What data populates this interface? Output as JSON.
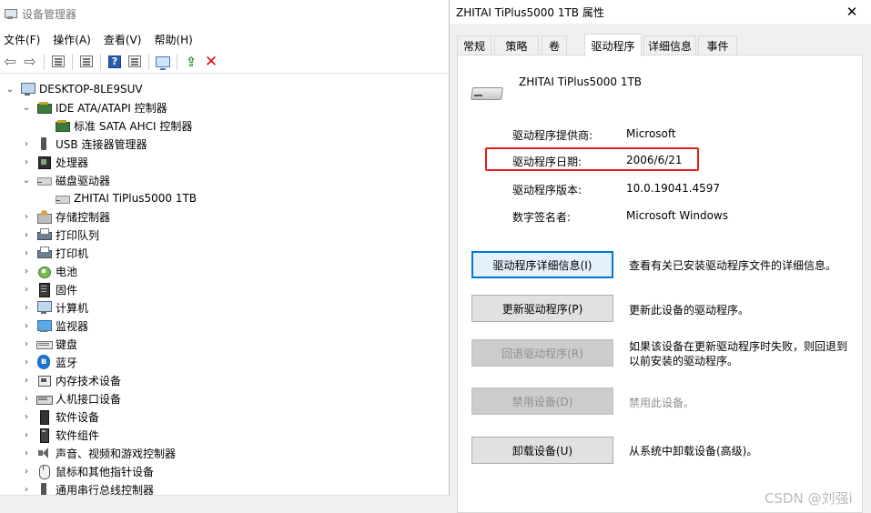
{
  "device_manager": {
    "title": "设备管理器",
    "menu": [
      "文件(F)",
      "操作(A)",
      "查看(V)",
      "帮助(H)"
    ],
    "tree": [
      {
        "label": "DESKTOP-8LE9SUV",
        "icon": "computer-icon",
        "level": 0,
        "expander": "expanded"
      },
      {
        "label": "IDE ATA/ATAPI 控制器",
        "icon": "ide-controller-icon",
        "level": 1,
        "expander": "expanded"
      },
      {
        "label": "标准 SATA AHCI 控制器",
        "icon": "ide-controller-icon",
        "level": 2,
        "expander": "none"
      },
      {
        "label": "USB 连接器管理器",
        "icon": "usb-icon",
        "level": 1,
        "expander": "collapsed"
      },
      {
        "label": "处理器",
        "icon": "processor-icon",
        "level": 1,
        "expander": "collapsed"
      },
      {
        "label": "磁盘驱动器",
        "icon": "disk-drive-icon",
        "level": 1,
        "expander": "expanded"
      },
      {
        "label": "ZHITAI TiPlus5000 1TB",
        "icon": "disk-drive-icon",
        "level": 2,
        "expander": "none"
      },
      {
        "label": "存储控制器",
        "icon": "storage-controller-icon",
        "level": 1,
        "expander": "collapsed"
      },
      {
        "label": "打印队列",
        "icon": "printer-icon",
        "level": 1,
        "expander": "collapsed"
      },
      {
        "label": "打印机",
        "icon": "printer-icon",
        "level": 1,
        "expander": "collapsed"
      },
      {
        "label": "电池",
        "icon": "battery-icon",
        "level": 1,
        "expander": "collapsed"
      },
      {
        "label": "固件",
        "icon": "firmware-icon",
        "level": 1,
        "expander": "collapsed"
      },
      {
        "label": "计算机",
        "icon": "computer-icon",
        "level": 1,
        "expander": "collapsed"
      },
      {
        "label": "监视器",
        "icon": "monitor-icon",
        "level": 1,
        "expander": "collapsed"
      },
      {
        "label": "键盘",
        "icon": "keyboard-icon",
        "level": 1,
        "expander": "collapsed"
      },
      {
        "label": "蓝牙",
        "icon": "bluetooth-icon",
        "level": 1,
        "expander": "collapsed"
      },
      {
        "label": "内存技术设备",
        "icon": "memory-icon",
        "level": 1,
        "expander": "collapsed"
      },
      {
        "label": "人机接口设备",
        "icon": "hid-icon",
        "level": 1,
        "expander": "collapsed"
      },
      {
        "label": "软件设备",
        "icon": "software-device-icon",
        "level": 1,
        "expander": "collapsed"
      },
      {
        "label": "软件组件",
        "icon": "software-component-icon",
        "level": 1,
        "expander": "collapsed"
      },
      {
        "label": "声音、视频和游戏控制器",
        "icon": "sound-icon",
        "level": 1,
        "expander": "collapsed"
      },
      {
        "label": "鼠标和其他指针设备",
        "icon": "mouse-icon",
        "level": 1,
        "expander": "collapsed"
      },
      {
        "label": "通用串行总线控制器",
        "icon": "usb-icon",
        "level": 1,
        "expander": "collapsed"
      }
    ]
  },
  "properties": {
    "title": "ZHITAI TiPlus5000 1TB 属性",
    "tabs": [
      "常规",
      "策略",
      "卷",
      "驱动程序",
      "详细信息",
      "事件"
    ],
    "active_tab": "驱动程序",
    "device_name": "ZHITAI TiPlus5000 1TB",
    "fields": [
      {
        "label": "驱动程序提供商:",
        "value": "Microsoft"
      },
      {
        "label": "驱动程序日期:",
        "value": "2006/6/21"
      },
      {
        "label": "驱动程序版本:",
        "value": "10.0.19041.4597"
      },
      {
        "label": "数字签名者:",
        "value": "Microsoft Windows"
      }
    ],
    "highlighted_field": "驱动程序日期:",
    "highlight_color": "#e02020",
    "buttons": [
      {
        "label": "驱动程序详细信息(I)",
        "description": "查看有关已安装驱动程序文件的详细信息。",
        "enabled": true,
        "focused": true
      },
      {
        "label": "更新驱动程序(P)",
        "description": "更新此设备的驱动程序。",
        "enabled": true,
        "focused": false
      },
      {
        "label": "回退驱动程序(R)",
        "description": "如果该设备在更新驱动程序时失败，则回退到以前安装的驱动程序。",
        "enabled": false,
        "focused": false
      },
      {
        "label": "禁用设备(D)",
        "description": "禁用此设备。",
        "enabled": false,
        "focused": false
      },
      {
        "label": "卸载设备(U)",
        "description": "从系统中卸载设备(高级)。",
        "enabled": true,
        "focused": false
      }
    ]
  },
  "watermark": "CSDN @刘强i"
}
